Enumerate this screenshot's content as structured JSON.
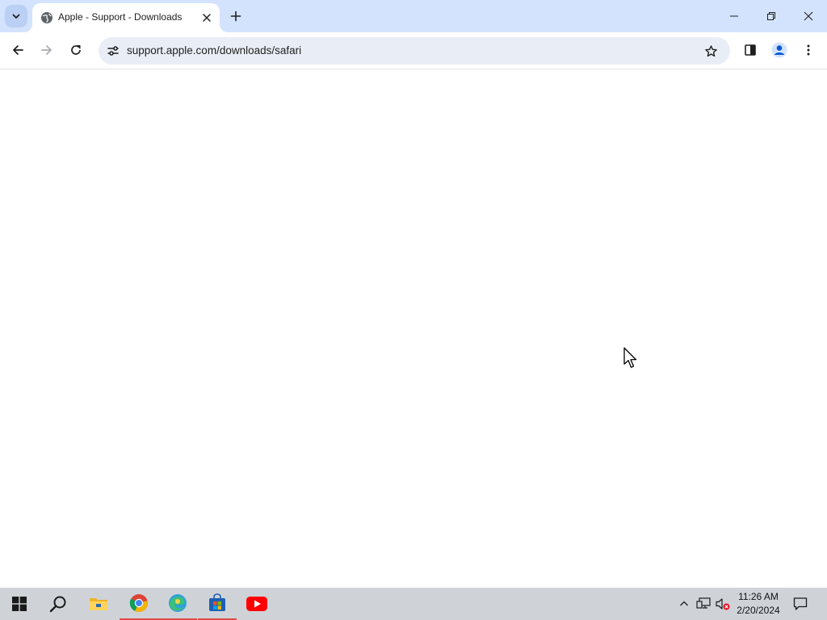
{
  "browser": {
    "tab": {
      "title": "Apple - Support - Downloads",
      "favicon": "globe-icon"
    },
    "address_bar": {
      "url": "support.apple.com/downloads/safari"
    },
    "icons": {
      "tab_search": "chevron-down-icon",
      "tab_close": "close-icon",
      "new_tab": "plus-icon",
      "minimize": "minimize-icon",
      "restore": "restore-icon",
      "close": "close-icon",
      "back": "back-arrow-icon",
      "forward": "forward-arrow-icon",
      "reload": "reload-icon",
      "site_info": "tune-icon",
      "bookmark": "star-icon",
      "side_panel": "side-panel-icon",
      "profile": "profile-icon",
      "menu": "more-vert-icon"
    }
  },
  "taskbar": {
    "apps": [
      {
        "name": "start",
        "icon": "windows-logo-icon"
      },
      {
        "name": "search",
        "icon": "search-icon"
      },
      {
        "name": "file-explorer",
        "icon": "folder-icon"
      },
      {
        "name": "chrome",
        "icon": "chrome-icon",
        "active": true
      },
      {
        "name": "edge",
        "icon": "edge-icon",
        "active": true
      },
      {
        "name": "store",
        "icon": "store-icon",
        "active": true
      },
      {
        "name": "youtube",
        "icon": "youtube-icon"
      }
    ],
    "tray": {
      "icons": [
        "chevron-up-icon",
        "network-icon",
        "volume-muted-icon",
        "notifications-icon"
      ]
    },
    "clock": {
      "time": "11:26 AM",
      "date": "2/20/2024"
    }
  },
  "colors": {
    "tabstrip": "#d3e3fd",
    "omnibox": "#e9eef6",
    "taskbar": "#cfd3d8",
    "active_indicator": "#e04a4a"
  }
}
